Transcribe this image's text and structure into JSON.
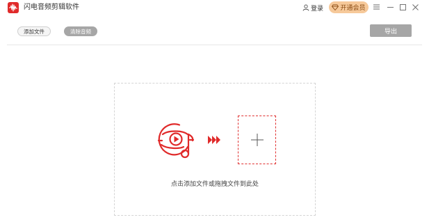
{
  "titlebar": {
    "app_title": "闪电音频剪辑软件",
    "login_label": "登录",
    "vip_label": "开通会员"
  },
  "toolbar": {
    "add_file_label": "添加文件",
    "clear_audio_label": "清除音频",
    "export_label": "导出"
  },
  "main": {
    "drop_hint": "点击添加文件或拖拽文件到此处"
  },
  "icons": {
    "logo": "waveform-logo-icon",
    "login": "user-icon",
    "vip": "diamond-icon",
    "menu": "menu-icon",
    "minimize": "minimize-icon",
    "maximize": "maximize-icon",
    "close": "close-icon",
    "music": "music-disc-icon",
    "arrow": "triple-arrow-icon",
    "add": "plus-icon"
  },
  "colors": {
    "accent": "#e02a2a",
    "vip_bg": "#f6c99a",
    "disabled_button": "#a6a6a6"
  }
}
